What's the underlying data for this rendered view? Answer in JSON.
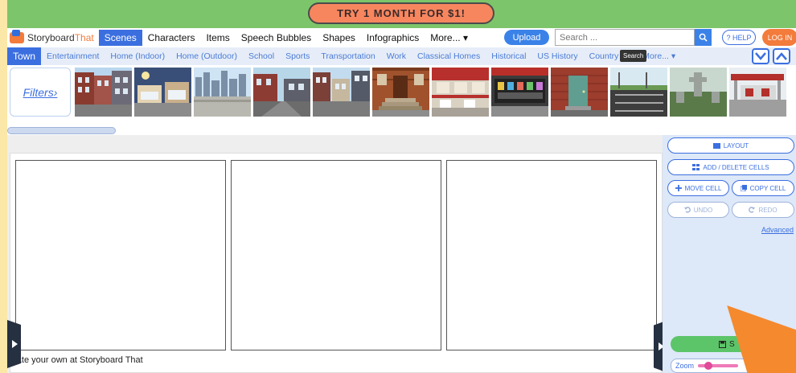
{
  "promo": {
    "label": "TRY 1 MONTH FOR $1!"
  },
  "header": {
    "logo_main": "Storyboard",
    "logo_accent": "That",
    "nav": [
      "Scenes",
      "Characters",
      "Items",
      "Speech Bubbles",
      "Shapes",
      "Infographics",
      "More... ▾"
    ],
    "upload_label": "Upload",
    "search_placeholder": "Search ...",
    "help_label": "? HELP",
    "login_label": "LOG IN"
  },
  "categories": {
    "items": [
      "Town",
      "Entertainment",
      "Home (Indoor)",
      "Home (Outdoor)",
      "School",
      "Sports",
      "Transportation",
      "Work",
      "Classical Homes",
      "Historical",
      "US History",
      "Country &",
      "More... ▾"
    ],
    "tooltip": "Search"
  },
  "thumbnails": {
    "filters_label": "Filters›",
    "scenes": [
      "brick-row-houses",
      "storefront-street",
      "city-skyline-plaza",
      "street-corner",
      "city-street",
      "brownstone-stairs",
      "restaurant-patio",
      "shop-window",
      "door-alley",
      "parking-lot",
      "cemetery",
      "gas-station"
    ]
  },
  "board": {
    "footer_text": "reate your own at Storyboard That"
  },
  "panel": {
    "layout_label": "LAYOUT",
    "add_delete_label": "ADD / DELETE CELLS",
    "move_cell_label": "MOVE CELL",
    "copy_cell_label": "COPY CELL",
    "undo_label": "UNDO",
    "redo_label": "REDO",
    "advanced_label": "Advanced",
    "save_label": "S",
    "zoom_label": "Zoom",
    "zoom_level": 0.2
  },
  "colors": {
    "accent_blue": "#3b6fe0",
    "promo_green": "#7dc56a",
    "orange": "#f37b3b"
  }
}
